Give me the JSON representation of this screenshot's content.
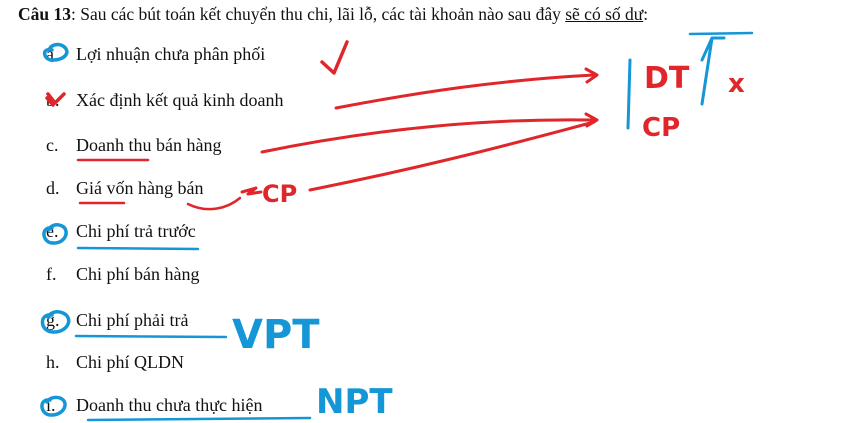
{
  "question": {
    "number": "Câu 13",
    "text_before": ": Sau các bút toán kết chuyển thu chi, lãi lỗ, các tài khoản nào sau đây ",
    "text_underlined": "sẽ có số dư",
    "text_after": ":"
  },
  "options": [
    {
      "letter": "a.",
      "text": "Lợi nhuận chưa phân phối"
    },
    {
      "letter": "b.",
      "text": "Xác định kết quả kinh doanh"
    },
    {
      "letter": "c.",
      "text": "Doanh thu bán hàng"
    },
    {
      "letter": "d.",
      "text": "Giá vốn hàng bán"
    },
    {
      "letter": "e.",
      "text": "Chi phí trả trước"
    },
    {
      "letter": "f.",
      "text": "Chi phí bán hàng"
    },
    {
      "letter": "g.",
      "text": "Chi phí phải trả"
    },
    {
      "letter": "h.",
      "text": "Chi phí QLDN"
    },
    {
      "letter": "i.",
      "text": "Doanh thu chưa thực hiện"
    }
  ],
  "annotations": {
    "red_cp": "CP",
    "red_dt": "DT",
    "red_cp2": "CP",
    "red_x": "x",
    "blue_vpt": "VPT",
    "blue_npt": "NPT"
  },
  "colors": {
    "red_ink": "#e0262a",
    "blue_ink": "#1596d6"
  }
}
